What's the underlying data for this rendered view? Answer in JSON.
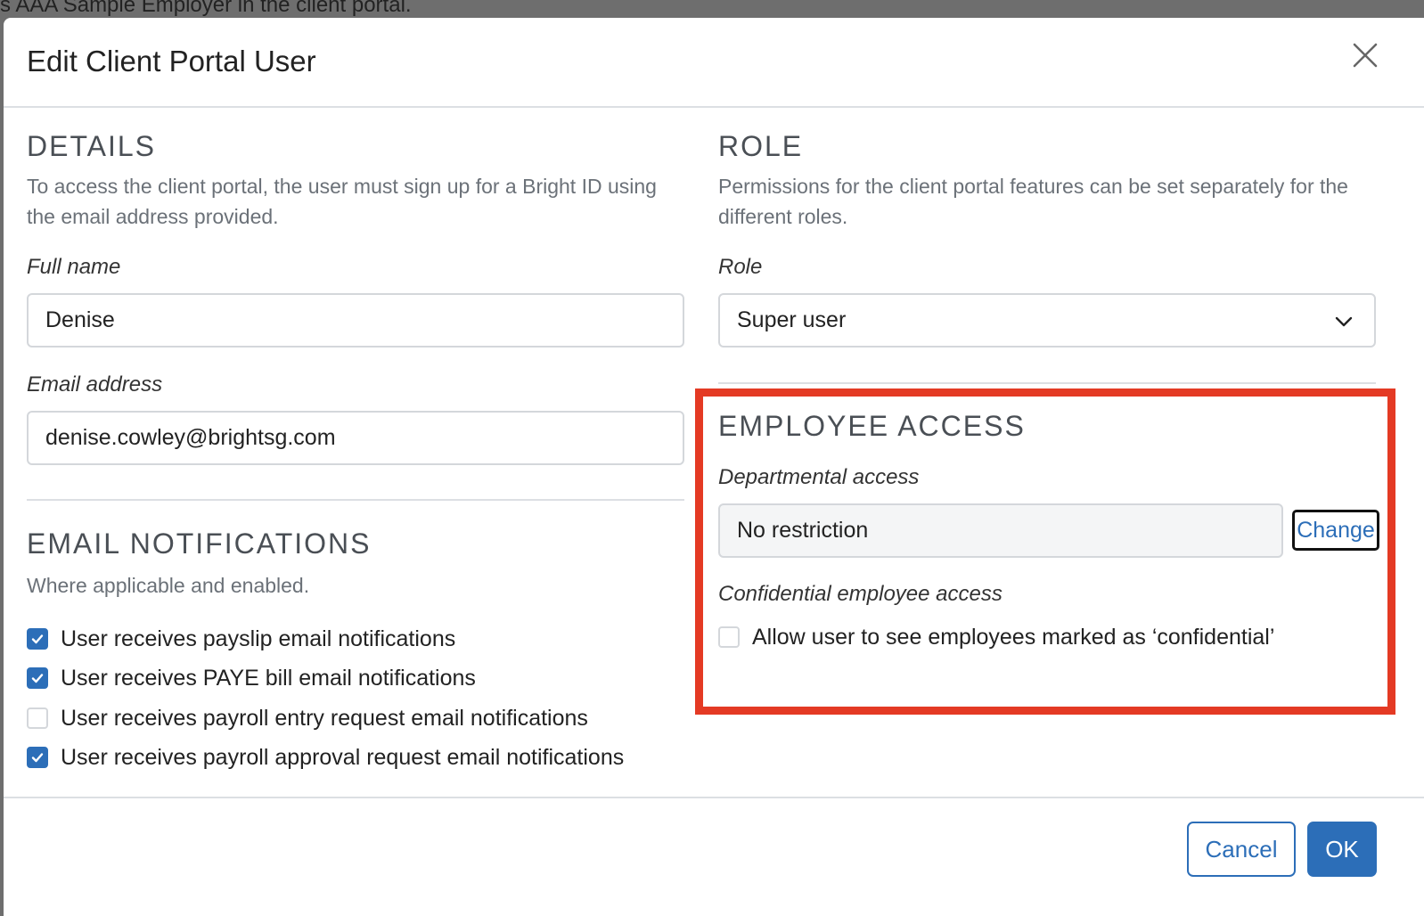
{
  "backdrop": {
    "text": "s AAA Sample Employer in the client portal."
  },
  "modal": {
    "title": "Edit Client Portal User",
    "close_icon": "close-icon"
  },
  "details": {
    "heading": "DETAILS",
    "help": "To access the client portal, the user must sign up for a Bright ID using the email address provided.",
    "full_name_label": "Full name",
    "full_name_value": "Denise",
    "email_label": "Email address",
    "email_value": "denise.cowley@brightsg.com"
  },
  "role": {
    "heading": "ROLE",
    "help": "Permissions for the client portal features can be set separately for the different roles.",
    "role_label": "Role",
    "role_value": "Super user",
    "chevron_icon": "chevron-down-icon"
  },
  "notifications": {
    "heading": "EMAIL NOTIFICATIONS",
    "help": "Where applicable and enabled.",
    "items": [
      {
        "label": "User receives payslip email notifications",
        "checked": true
      },
      {
        "label": "User receives PAYE bill email notifications",
        "checked": true
      },
      {
        "label": "User receives payroll entry request email notifications",
        "checked": false
      },
      {
        "label": "User receives payroll approval request email notifications",
        "checked": true
      }
    ]
  },
  "employee_access": {
    "heading": "EMPLOYEE ACCESS",
    "departmental_label": "Departmental access",
    "departmental_value": "No restriction",
    "change_label": "Change",
    "confidential_label": "Confidential employee access",
    "confidential_checkbox_label": "Allow user to see employees marked as ‘confidential’",
    "confidential_checked": false
  },
  "footer": {
    "cancel_label": "Cancel",
    "ok_label": "OK"
  },
  "colors": {
    "accent": "#2c6eb8",
    "highlight": "#e43a24"
  }
}
